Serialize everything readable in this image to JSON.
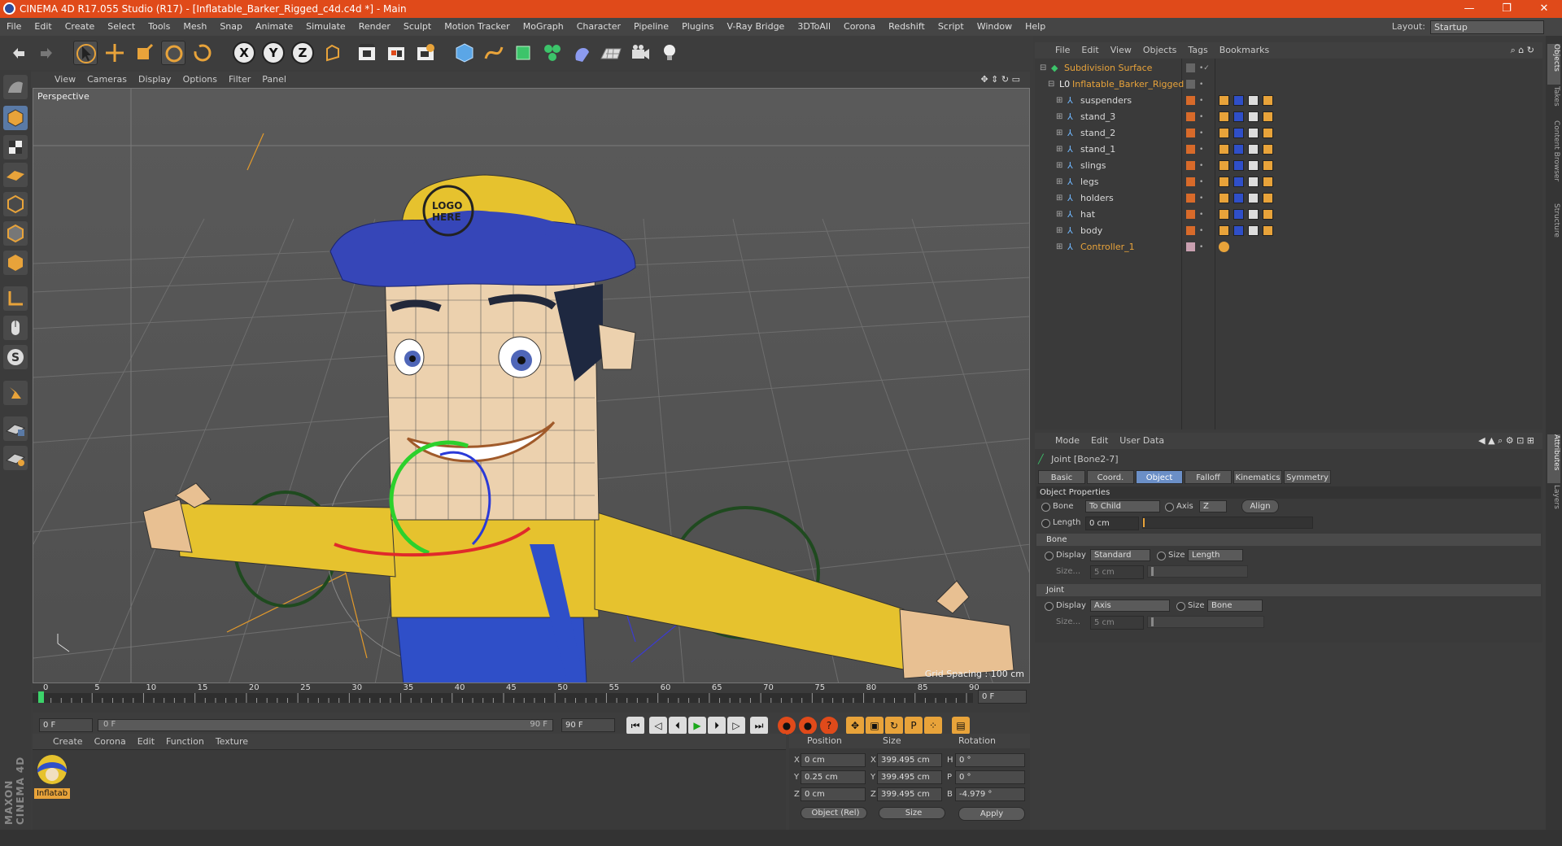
{
  "window": {
    "title": "CINEMA 4D R17.055 Studio (R17) - [Inflatable_Barker_Rigged_c4d.c4d *] - Main",
    "minimize": "—",
    "restore": "❐",
    "close": "✕"
  },
  "menubar": {
    "items": [
      "File",
      "Edit",
      "Create",
      "Select",
      "Tools",
      "Mesh",
      "Snap",
      "Animate",
      "Simulate",
      "Render",
      "Sculpt",
      "Motion Tracker",
      "MoGraph",
      "Character",
      "Pipeline",
      "Plugins",
      "V-Ray Bridge",
      "3DToAll",
      "Corona",
      "Redshift",
      "Script",
      "Window",
      "Help"
    ],
    "layout_label": "Layout:",
    "layout_value": "Startup"
  },
  "toolbar": {
    "axis_x": "X",
    "axis_y": "Y",
    "axis_z": "Z"
  },
  "viewport": {
    "menu": [
      "View",
      "Cameras",
      "Display",
      "Options",
      "Filter",
      "Panel"
    ],
    "label": "Perspective",
    "grid_spacing": "Grid Spacing : 100 cm",
    "cap_text_line1": "LOGO",
    "cap_text_line2": "HERE"
  },
  "timeline": {
    "ticks": [
      "0",
      "5",
      "10",
      "15",
      "20",
      "25",
      "30",
      "35",
      "40",
      "45",
      "50",
      "55",
      "60",
      "65",
      "70",
      "75",
      "80",
      "85",
      "90"
    ],
    "current_frame": "0 F",
    "start_frame": "0 F",
    "range_start": "0 F",
    "range_end": "90 F",
    "end_frame": "90 F"
  },
  "material_manager": {
    "menu": [
      "Create",
      "Corona",
      "Edit",
      "Function",
      "Texture"
    ],
    "material_name": "Inflatab"
  },
  "coordinates": {
    "headers": [
      "Position",
      "Size",
      "Rotation"
    ],
    "rows": [
      {
        "axis": "X",
        "pos": "0 cm",
        "size_axis": "X",
        "size": "399.495 cm",
        "rot_axis": "H",
        "rot": "0 °"
      },
      {
        "axis": "Y",
        "pos": "0.25 cm",
        "size_axis": "Y",
        "size": "399.495 cm",
        "rot_axis": "P",
        "rot": "0 °"
      },
      {
        "axis": "Z",
        "pos": "0 cm",
        "size_axis": "Z",
        "size": "399.495 cm",
        "rot_axis": "B",
        "rot": "-4.979 °"
      }
    ],
    "mode": "Object (Rel)",
    "size_mode": "Size",
    "apply": "Apply"
  },
  "brand": "MAXON CINEMA 4D",
  "object_manager": {
    "menu": [
      "File",
      "Edit",
      "View",
      "Objects",
      "Tags",
      "Bookmarks"
    ],
    "objects": [
      {
        "name": "Subdivision Surface",
        "color": "#e8a33a"
      },
      {
        "name": "Inflatable_Barker_Rigged",
        "color": "#e8a33a"
      },
      {
        "name": "suspenders",
        "color": "#d8d8d8"
      },
      {
        "name": "stand_3",
        "color": "#d8d8d8"
      },
      {
        "name": "stand_2",
        "color": "#d8d8d8"
      },
      {
        "name": "stand_1",
        "color": "#d8d8d8"
      },
      {
        "name": "slings",
        "color": "#d8d8d8"
      },
      {
        "name": "legs",
        "color": "#d8d8d8"
      },
      {
        "name": "holders",
        "color": "#d8d8d8"
      },
      {
        "name": "hat",
        "color": "#d8d8d8"
      },
      {
        "name": "body",
        "color": "#d8d8d8"
      },
      {
        "name": "Controller_1",
        "color": "#e8a33a"
      }
    ]
  },
  "attributes": {
    "menu": [
      "Mode",
      "Edit",
      "User Data"
    ],
    "object_title": "Joint [Bone2-7]",
    "tabs": [
      "Basic",
      "Coord.",
      "Object",
      "Falloff",
      "Kinematics",
      "Symmetry"
    ],
    "active_tab": "Object",
    "section_title": "Object Properties",
    "bone_label": "Bone",
    "bone_value": "To Child",
    "axis_label": "Axis",
    "axis_value": "Z",
    "align": "Align",
    "length_label": "Length",
    "length_value": "0 cm",
    "group_bone": "Bone",
    "bone_display_label": "Display",
    "bone_display_value": "Standard",
    "bone_size_label": "Size",
    "bone_size_value": "Length",
    "bone_size_field_label": "Size...",
    "bone_size_field_value": "5 cm",
    "group_joint": "Joint",
    "joint_display_label": "Display",
    "joint_display_value": "Axis",
    "joint_size_label": "Size",
    "joint_size_value": "Bone",
    "joint_size_field_label": "Size...",
    "joint_size_field_value": "5 cm"
  },
  "right_tabs": [
    "Objects",
    "Takes",
    "Content Browser",
    "Structure",
    "Attributes",
    "Layers"
  ]
}
